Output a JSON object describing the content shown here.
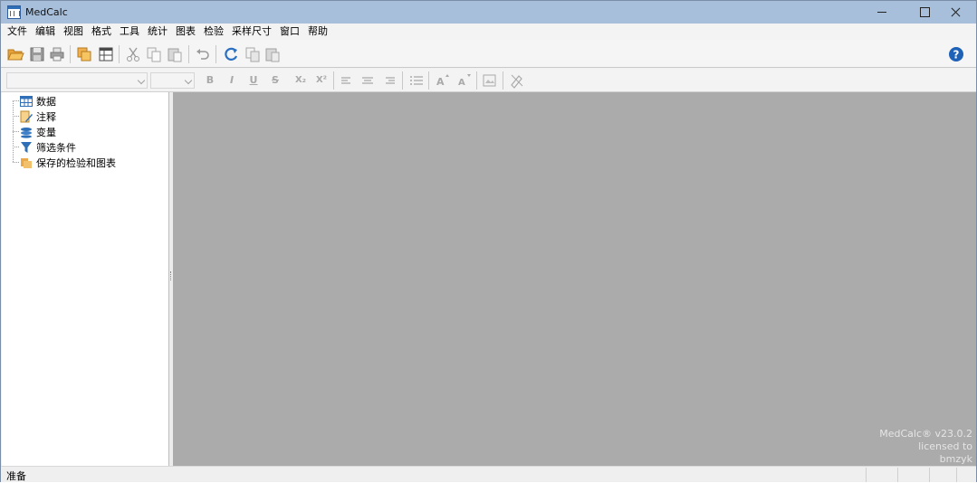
{
  "window": {
    "title": "MedCalc"
  },
  "menu": [
    "文件",
    "编辑",
    "视图",
    "格式",
    "工具",
    "统计",
    "图表",
    "检验",
    "采样尺寸",
    "窗口",
    "帮助"
  ],
  "toolbar": {
    "icons": [
      "open-icon",
      "save-icon",
      "print-icon",
      "copy-sheet-icon",
      "spreadsheet-icon",
      "cut-icon",
      "copy-icon",
      "paste-icon",
      "undo-icon",
      "refresh-icon",
      "copy-graph-icon",
      "paste-graph-icon",
      "help-icon"
    ]
  },
  "format_toolbar": {
    "bold": "B",
    "italic": "I",
    "underline": "U",
    "strike": "S",
    "subscript": "X₂",
    "superscript": "X²"
  },
  "tree": {
    "items": [
      {
        "label": "数据",
        "icon": "grid-icon"
      },
      {
        "label": "注释",
        "icon": "note-icon"
      },
      {
        "label": "变量",
        "icon": "variables-icon"
      },
      {
        "label": "筛选条件",
        "icon": "filter-icon"
      },
      {
        "label": "保存的检验和图表",
        "icon": "folder-icon"
      }
    ]
  },
  "license": {
    "product": "MedCalc® v23.0.2",
    "line2": "licensed to",
    "line3": "bmzyk"
  },
  "status": {
    "text": "准备"
  },
  "colors": {
    "titlebar": "#a7bfda",
    "workspace": "#ababab",
    "accent": "#2f6fb8"
  }
}
